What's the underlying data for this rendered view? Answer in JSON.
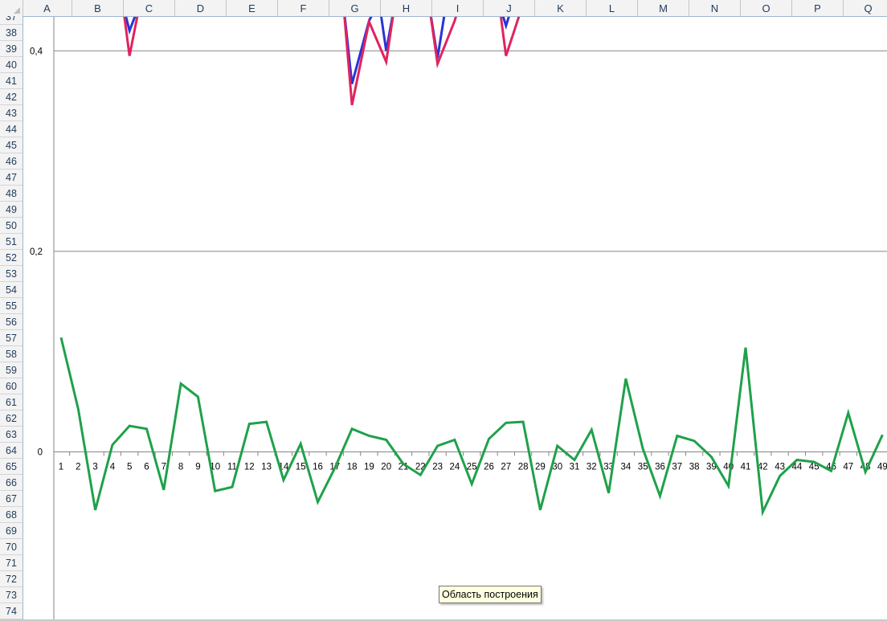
{
  "spreadsheet": {
    "columns": [
      "A",
      "B",
      "C",
      "D",
      "E",
      "F",
      "G",
      "H",
      "I",
      "J",
      "K",
      "L",
      "M",
      "N",
      "O",
      "P",
      "Q"
    ],
    "rows": [
      "37",
      "38",
      "39",
      "40",
      "41",
      "42",
      "43",
      "44",
      "45",
      "46",
      "47",
      "48",
      "49",
      "50",
      "51",
      "52",
      "53",
      "54",
      "55",
      "56",
      "57",
      "58",
      "59",
      "60",
      "61",
      "62",
      "63",
      "64",
      "65",
      "66",
      "67",
      "68",
      "69",
      "70",
      "71",
      "72",
      "73",
      "74"
    ]
  },
  "tooltip": {
    "text": "Область построения"
  },
  "chart_data": {
    "type": "line",
    "y_tick_labels": [
      "0,4",
      "0,2",
      "0"
    ],
    "y_ticks": [
      0.4,
      0.2,
      0
    ],
    "ylim": [
      -0.166,
      0.435
    ],
    "x": [
      1,
      2,
      3,
      4,
      5,
      6,
      7,
      8,
      9,
      10,
      11,
      12,
      13,
      14,
      15,
      16,
      17,
      18,
      19,
      20,
      21,
      22,
      23,
      24,
      25,
      26,
      27,
      28,
      29,
      30,
      31,
      32,
      33,
      34,
      35,
      36,
      37,
      38,
      39,
      40,
      41,
      42,
      43,
      44,
      45,
      46,
      47,
      48,
      49
    ],
    "series_colors": [
      "#1fa14a",
      "#2a34d4",
      "#e0245e"
    ],
    "series": [
      {
        "color": "#1fa14a",
        "values": [
          0.114,
          0.043,
          -0.058,
          0.007,
          0.026,
          0.023,
          -0.038,
          0.068,
          0.055,
          -0.039,
          -0.035,
          0.028,
          0.03,
          -0.028,
          0.008,
          -0.05,
          -0.016,
          0.023,
          0.016,
          0.012,
          -0.012,
          -0.023,
          0.006,
          0.012,
          -0.032,
          0.013,
          0.029,
          0.03,
          -0.058,
          0.006,
          -0.008,
          0.022,
          -0.041,
          0.073,
          0.003,
          -0.044,
          0.016,
          0.011,
          -0.005,
          -0.034,
          0.104,
          -0.06,
          -0.024,
          -0.008,
          -0.01,
          -0.019,
          0.039,
          -0.02,
          0.017
        ]
      },
      {
        "color": "#2a34d4",
        "points": [
          [
            4.6,
            0.447
          ],
          [
            5,
            0.42
          ],
          [
            5.6,
            0.447
          ],
          [
            17.5,
            0.447
          ],
          [
            18,
            0.367
          ],
          [
            19,
            0.43
          ],
          [
            19.5,
            0.447
          ],
          [
            19.6,
            0.447
          ],
          [
            20,
            0.4
          ],
          [
            20.5,
            0.447
          ],
          [
            22.5,
            0.447
          ],
          [
            23,
            0.393
          ],
          [
            23.5,
            0.447
          ],
          [
            26.6,
            0.447
          ],
          [
            27,
            0.425
          ],
          [
            27.4,
            0.447
          ]
        ]
      },
      {
        "color": "#e0245e",
        "points": [
          [
            4.6,
            0.447
          ],
          [
            5,
            0.395
          ],
          [
            5.6,
            0.447
          ],
          [
            17.5,
            0.447
          ],
          [
            18,
            0.346
          ],
          [
            19,
            0.429
          ],
          [
            20,
            0.389
          ],
          [
            20.5,
            0.447
          ],
          [
            22.5,
            0.447
          ],
          [
            23,
            0.387
          ],
          [
            24,
            0.43
          ],
          [
            24.3,
            0.447
          ],
          [
            26.6,
            0.447
          ],
          [
            27,
            0.395
          ],
          [
            28,
            0.447
          ],
          [
            47,
            0.443
          ],
          [
            47.05,
            0.447
          ]
        ]
      }
    ]
  }
}
